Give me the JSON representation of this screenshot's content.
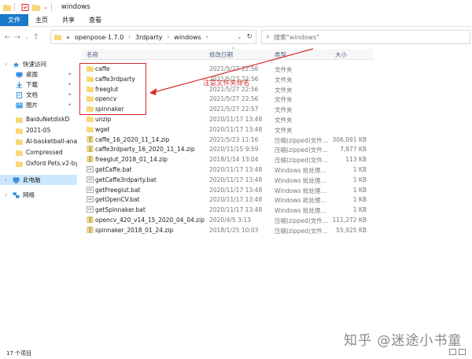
{
  "window": {
    "title": "windows"
  },
  "ribbon": {
    "tabs": [
      "文件",
      "主页",
      "共享",
      "查看"
    ]
  },
  "address": {
    "overflow": "«",
    "segments": [
      "openpose-1.7.0",
      "3rdparty",
      "windows"
    ]
  },
  "search": {
    "placeholder": "搜索\"windows\""
  },
  "nav": {
    "items": [
      {
        "label": "快速访问",
        "icon": "star-icon",
        "pinned": false
      },
      {
        "label": "桌面",
        "icon": "desktop-icon",
        "pinned": true
      },
      {
        "label": "下载",
        "icon": "download-icon",
        "pinned": true
      },
      {
        "label": "文档",
        "icon": "document-icon",
        "pinned": true
      },
      {
        "label": "图片",
        "icon": "picture-icon",
        "pinned": true
      },
      {
        "label": "BaiduNetdiskD",
        "icon": "folder-icon",
        "pinned": false
      },
      {
        "label": "2021-05",
        "icon": "folder-icon",
        "pinned": false
      },
      {
        "label": "AI-basketball-ana",
        "icon": "folder-icon",
        "pinned": false
      },
      {
        "label": "Compressed",
        "icon": "folder-icon",
        "pinned": false
      },
      {
        "label": "Oxford Pets.v2-by",
        "icon": "folder-icon",
        "pinned": false
      },
      {
        "label": "此电脑",
        "icon": "computer-icon",
        "pinned": false
      },
      {
        "label": "网络",
        "icon": "network-icon",
        "pinned": false
      }
    ]
  },
  "columns": {
    "name": "名称",
    "date": "修改日期",
    "type": "类型",
    "size": "大小"
  },
  "files": [
    {
      "name": "caffe",
      "date": "2021/5/27 22:56",
      "type": "文件夹",
      "size": "",
      "icon": "folder-icon"
    },
    {
      "name": "caffe3rdparty",
      "date": "2021/5/27 22:56",
      "type": "文件夹",
      "size": "",
      "icon": "folder-icon"
    },
    {
      "name": "freeglut",
      "date": "2021/5/27 22:56",
      "type": "文件夹",
      "size": "",
      "icon": "folder-icon"
    },
    {
      "name": "opencv",
      "date": "2021/5/27 22:56",
      "type": "文件夹",
      "size": "",
      "icon": "folder-icon"
    },
    {
      "name": "spinnaker",
      "date": "2021/5/27 22:57",
      "type": "文件夹",
      "size": "",
      "icon": "folder-icon"
    },
    {
      "name": "unzip",
      "date": "2020/11/17 13:48",
      "type": "文件夹",
      "size": "",
      "icon": "folder-icon"
    },
    {
      "name": "wget",
      "date": "2020/11/17 13:48",
      "type": "文件夹",
      "size": "",
      "icon": "folder-icon"
    },
    {
      "name": "caffe_16_2020_11_14.zip",
      "date": "2021/5/23 11:16",
      "type": "压缩(zipped)文件...",
      "size": "306,091 KB",
      "icon": "zip-icon"
    },
    {
      "name": "caffe3rdparty_16_2020_11_14.zip",
      "date": "2020/11/15 9:59",
      "type": "压缩(zipped)文件...",
      "size": "7,877 KB",
      "icon": "zip-icon"
    },
    {
      "name": "freeglut_2018_01_14.zip",
      "date": "2018/1/14 13:04",
      "type": "压缩(zipped)文件...",
      "size": "113 KB",
      "icon": "zip-icon"
    },
    {
      "name": "getCaffe.bat",
      "date": "2020/11/17 13:48",
      "type": "Windows 批处理...",
      "size": "1 KB",
      "icon": "bat-icon"
    },
    {
      "name": "getCaffe3rdparty.bat",
      "date": "2020/11/17 13:48",
      "type": "Windows 批处理...",
      "size": "1 KB",
      "icon": "bat-icon"
    },
    {
      "name": "getFreeglut.bat",
      "date": "2020/11/17 13:48",
      "type": "Windows 批处理...",
      "size": "1 KB",
      "icon": "bat-icon"
    },
    {
      "name": "getOpenCV.bat",
      "date": "2020/11/17 13:48",
      "type": "Windows 批处理...",
      "size": "1 KB",
      "icon": "bat-icon"
    },
    {
      "name": "getSpinnaker.bat",
      "date": "2020/11/17 13:48",
      "type": "Windows 批处理...",
      "size": "1 KB",
      "icon": "bat-icon"
    },
    {
      "name": "opencv_420_v14_15_2020_04_04.zip",
      "date": "2020/4/5 3:13",
      "type": "压缩(zipped)文件...",
      "size": "111,272 KB",
      "icon": "zip-icon"
    },
    {
      "name": "spinnaker_2018_01_24.zip",
      "date": "2018/1/25 10:03",
      "type": "压缩(zipped)文件...",
      "size": "55,925 KB",
      "icon": "zip-icon"
    }
  ],
  "annotation": {
    "text": "注意文件夹命名"
  },
  "status": {
    "count": "17 个项目"
  },
  "watermark": {
    "text": "知乎 @迷途小书童"
  },
  "colors": {
    "accent": "#1979ca",
    "annotation": "#d62b2b",
    "folder": "#f8d775",
    "selection": "#cce8ff"
  }
}
